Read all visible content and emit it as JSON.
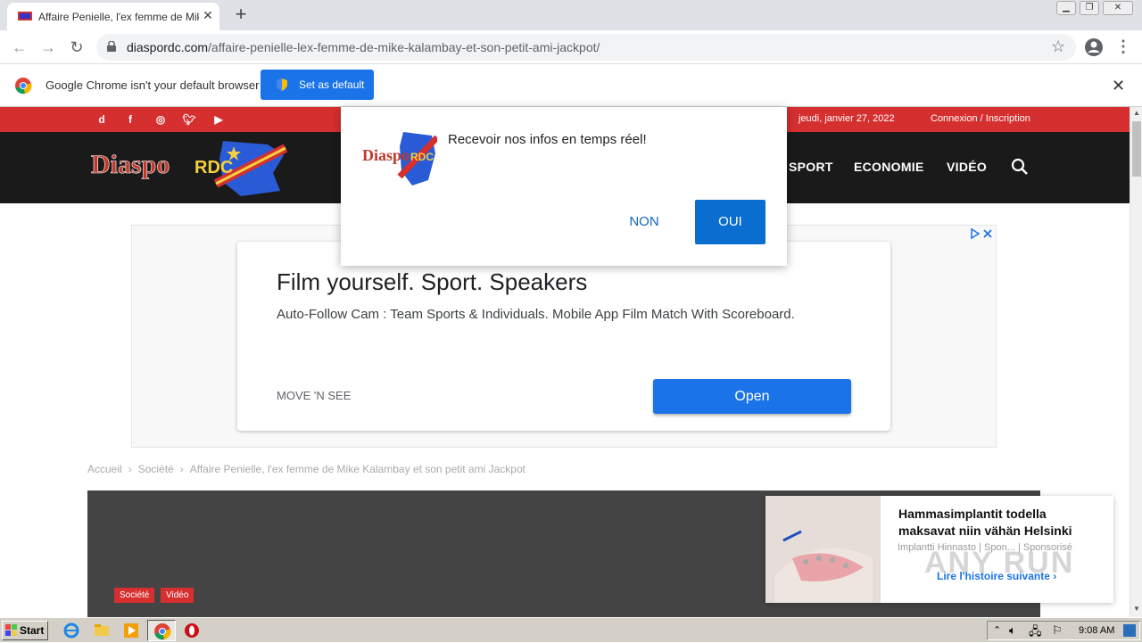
{
  "browser": {
    "tab_title": "Affaire Penielle, l'ex femme de Mike Kalambay et son petit ami Jackpot",
    "url_host": "diaspordc.com",
    "url_path": "/affaire-penielle-lex-femme-de-mike-kalambay-et-son-petit-ami-jackpot/",
    "infobar_text": "Google Chrome isn't your default browser",
    "set_default_label": "Set as default"
  },
  "site": {
    "date": "jeudi, janvier 27, 2022",
    "login": "Connexion / Inscription",
    "logo_text_1": "Diaspo",
    "logo_text_2": "RDC",
    "menu": [
      "SPORT",
      "ECONOMIE",
      "VIDÉO"
    ],
    "social": [
      "d",
      "f",
      "ig",
      "tw",
      "yt"
    ]
  },
  "ad": {
    "title": "Film yourself. Sport. Speakers",
    "description": "Auto-Follow Cam : Team Sports & Individuals. Mobile App Film Match With Scoreboard.",
    "brand": "MOVE 'N SEE",
    "open_label": "Open"
  },
  "breadcrumb": [
    "Accueil",
    "Société",
    "Affaire Penielle, l'ex femme de Mike Kalambay et son petit ami Jackpot"
  ],
  "hero": {
    "categories": [
      "Société",
      "Vidéo"
    ]
  },
  "popup": {
    "text": "Recevoir nos infos en temps réel!",
    "no_label": "NON",
    "yes_label": "OUI"
  },
  "sponsored": {
    "title": "Hammasimplantit todella maksavat niin vähän Helsinki",
    "source": "Implantti Hinnasto | Spon...",
    "sponsored_label": "| Sponsorisé",
    "more": "Lire l'histoire suivante ›"
  },
  "watermark": "ANY RUN",
  "taskbar": {
    "start_label": "Start",
    "clock": "9:08 AM"
  },
  "colors": {
    "site_red": "#d62f2f",
    "header_dark": "#1a1a1a",
    "chrome_blue": "#1a73e8"
  }
}
